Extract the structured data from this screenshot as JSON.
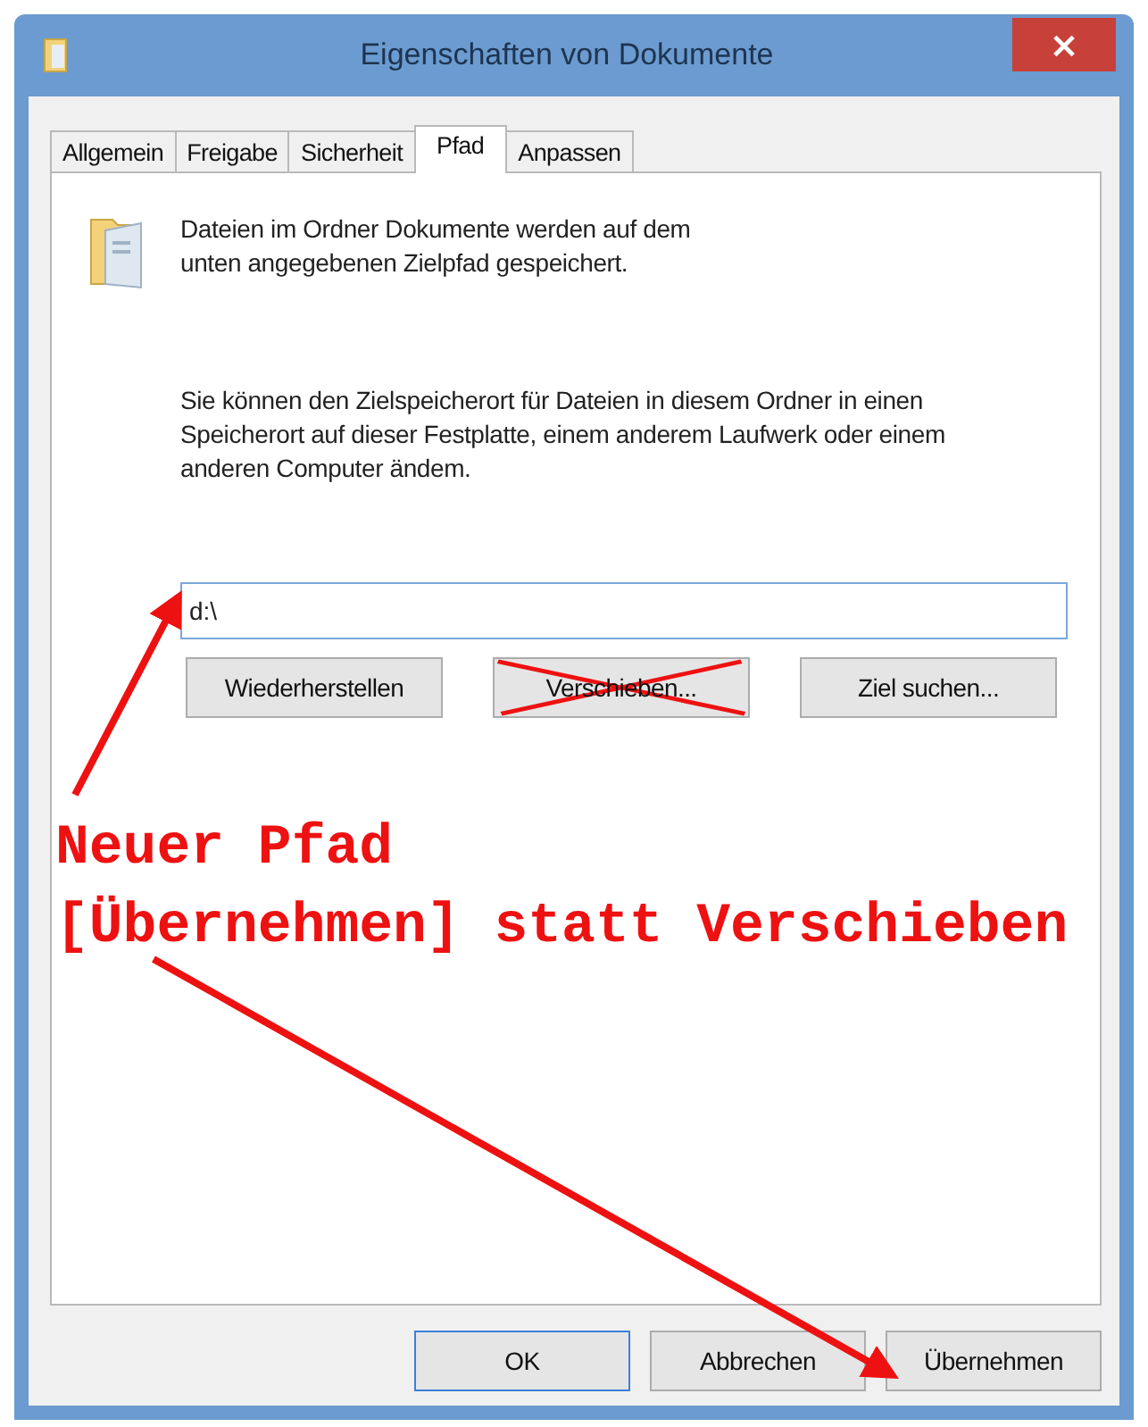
{
  "window": {
    "title": "Eigenschaften von Dokumente",
    "close": "×"
  },
  "tabs": [
    {
      "label": "Allgemein",
      "selected": false
    },
    {
      "label": "Freigabe",
      "selected": false
    },
    {
      "label": "Sicherheit",
      "selected": false
    },
    {
      "label": "Pfad",
      "selected": true
    },
    {
      "label": "Anpassen",
      "selected": false
    }
  ],
  "info": "Dateien im Ordner Dokumente werden auf dem unten angegebenen Zielpfad gespeichert.",
  "description": "Sie können den Zielspeicherort für Dateien in diesem Ordner in einen Speicherort auf dieser Festplatte, einem anderem Laufwerk oder einem anderen Computer ändem.",
  "path_field": {
    "value": "d:\\"
  },
  "path_buttons": [
    {
      "label": "Wiederherstellen",
      "crossed_out": false
    },
    {
      "label": "Verschieben...",
      "crossed_out": true
    },
    {
      "label": "Ziel suchen...",
      "crossed_out": false
    }
  ],
  "annotations": [
    "Neuer Pfad",
    "[Übernehmen] statt Verschieben"
  ],
  "footer_buttons": [
    {
      "label": "OK",
      "default": true
    },
    {
      "label": "Abbrechen",
      "default": false
    },
    {
      "label": "Übernehmen",
      "default": false
    }
  ]
}
